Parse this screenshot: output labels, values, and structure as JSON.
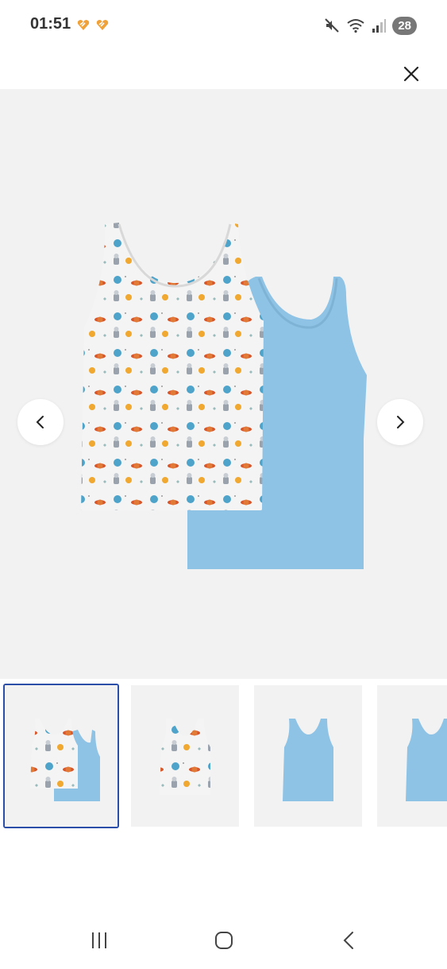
{
  "status_bar": {
    "time": "01:51",
    "battery_level": "28",
    "icons": [
      "app-notification-icon",
      "app-notification-icon",
      "mute-icon",
      "wifi-icon",
      "signal-icon"
    ]
  },
  "viewer": {
    "close_icon": "close-icon",
    "prev_icon": "chevron-left-icon",
    "next_icon": "chevron-right-icon",
    "main_image": "tank-tops-two-pack",
    "colors": {
      "background": "#f2f2f2",
      "blue_shirt": "#8ec3e6",
      "print_shirt": "#f4f4f4",
      "selected_border": "#2b4fa8"
    }
  },
  "thumbnails": [
    {
      "subject": "two-pack-tank-tops",
      "selected": true
    },
    {
      "subject": "printed-tank-top",
      "selected": false
    },
    {
      "subject": "blue-tank-top",
      "selected": false
    },
    {
      "subject": "blue-tank-top-partial",
      "selected": false
    }
  ],
  "nav_bar": {
    "icons": [
      "recent-apps-icon",
      "home-icon",
      "back-icon"
    ]
  }
}
